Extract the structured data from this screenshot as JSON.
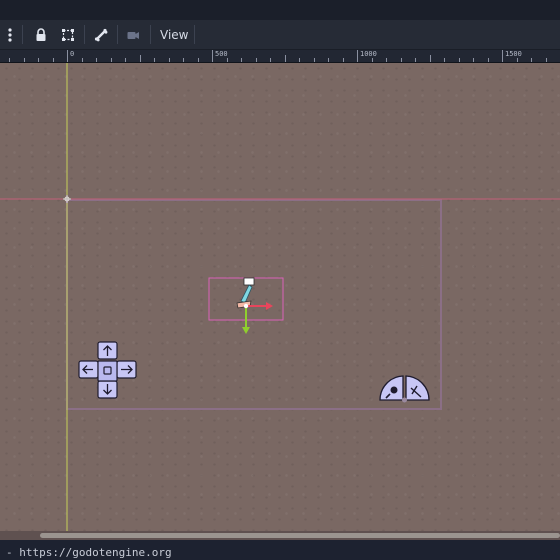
{
  "toolbar": {
    "view_label": "View",
    "icons": [
      "more-options-icon",
      "lock-icon",
      "group-icon",
      "bone-icon",
      "camera-icon"
    ]
  },
  "ruler": {
    "labels": [
      "0",
      "500",
      "1000",
      "1500"
    ]
  },
  "status": {
    "url_text": "- https://godotengine.org"
  },
  "colors": {
    "canvas_bg": "#7a6863",
    "toolbar_bg": "#262b36",
    "y_axis": "#c6d05a",
    "x_axis": "#c2607a",
    "selection": "#d962b8",
    "control_fill": "#c7c6f5"
  }
}
